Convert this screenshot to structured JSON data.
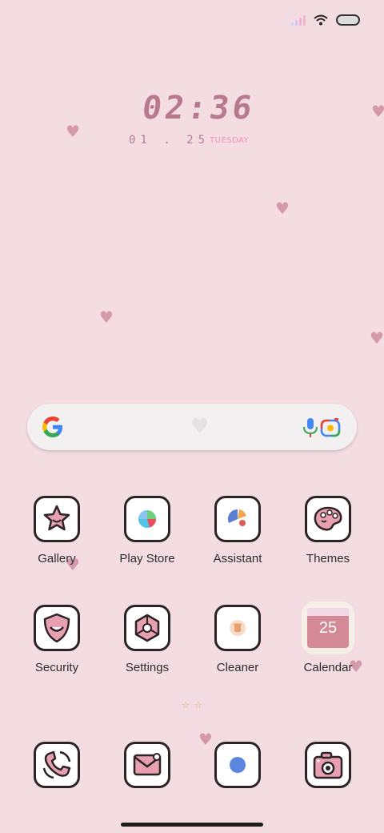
{
  "clock": {
    "time": "02:36",
    "date": "01 . 25",
    "day": "TUESDAY"
  },
  "search": {
    "g_icon": "google-g-icon",
    "mic_icon": "microphone-icon",
    "lens_icon": "google-lens-icon"
  },
  "apps_row1": [
    {
      "label": "Gallery",
      "icon": "star-icon"
    },
    {
      "label": "Play Store",
      "icon": "play-store-icon"
    },
    {
      "label": "Assistant",
      "icon": "assistant-icon"
    },
    {
      "label": "Themes",
      "icon": "palette-icon"
    }
  ],
  "apps_row2": [
    {
      "label": "Security",
      "icon": "shield-icon"
    },
    {
      "label": "Settings",
      "icon": "gear-icon"
    },
    {
      "label": "Cleaner",
      "icon": "trash-icon"
    },
    {
      "label": "Calendar",
      "icon": "calendar-icon",
      "day_number": "25"
    }
  ],
  "dock": [
    {
      "icon": "phone-icon"
    },
    {
      "icon": "messages-icon"
    },
    {
      "icon": "browser-icon"
    },
    {
      "icon": "camera-icon"
    }
  ],
  "colors": {
    "background": "#f4dde2",
    "accent_pink": "#d48a96",
    "clock": "#b77a8d"
  }
}
